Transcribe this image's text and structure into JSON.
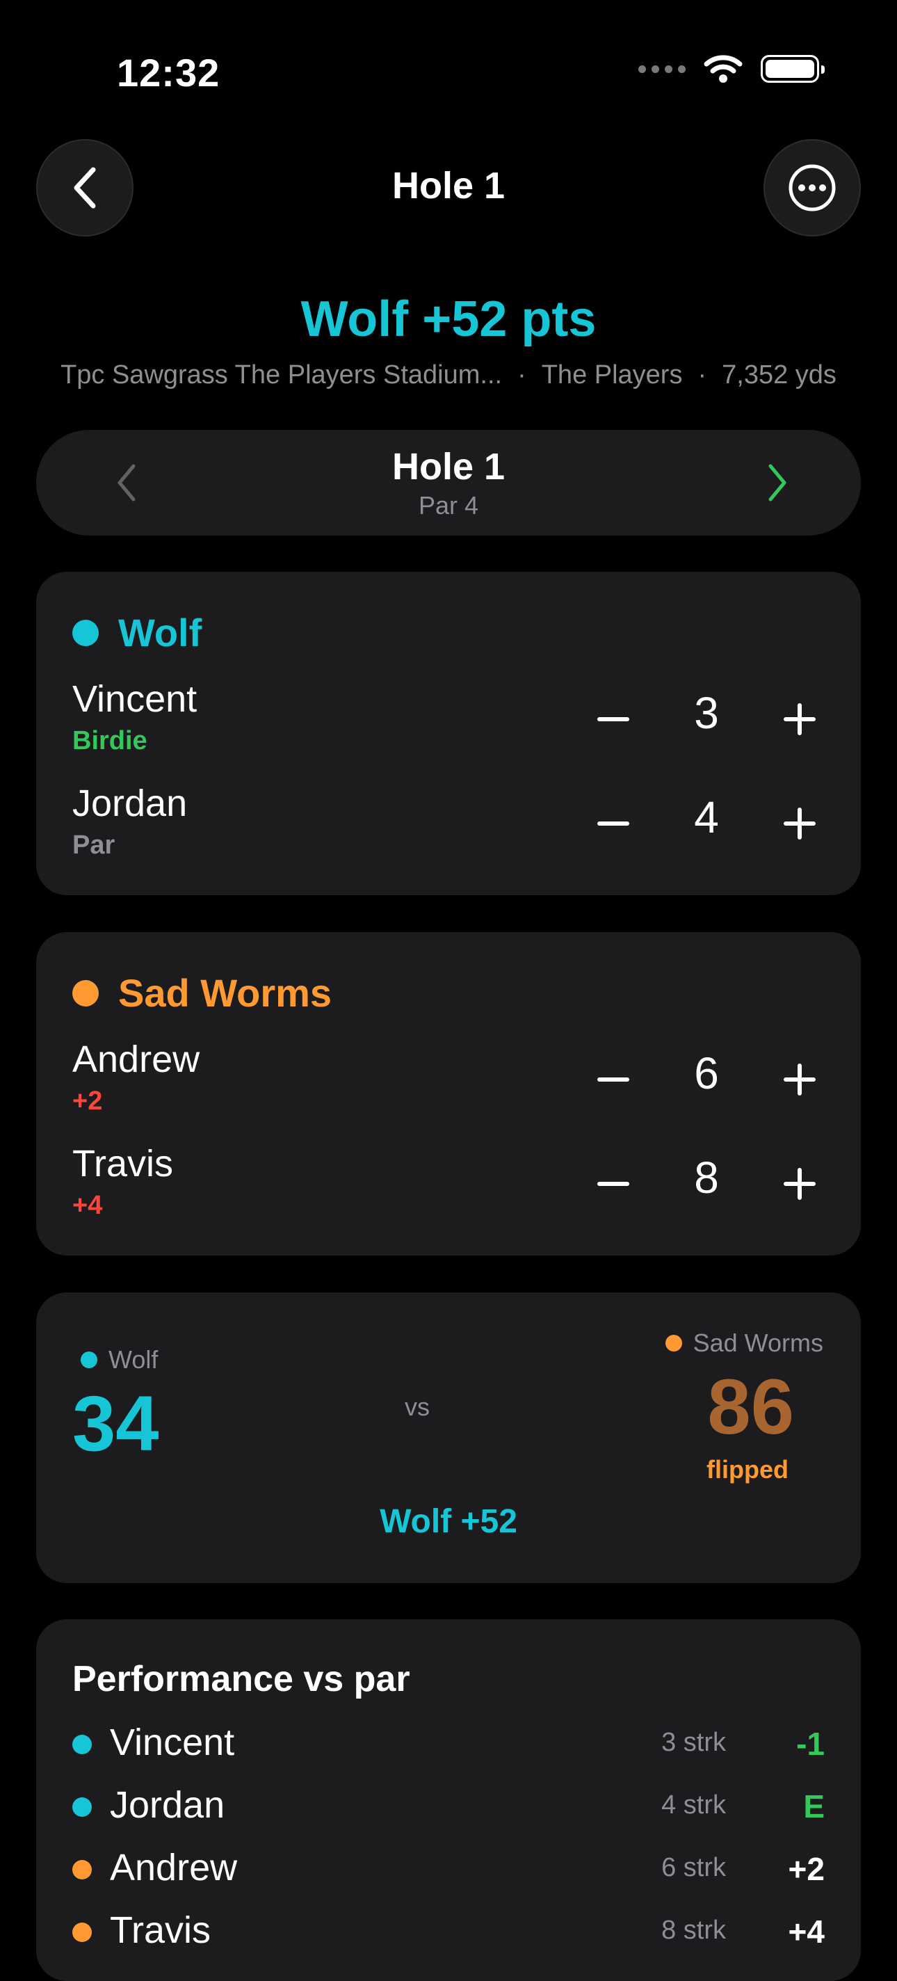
{
  "status": {
    "time": "12:32"
  },
  "nav": {
    "title": "Hole 1"
  },
  "summary": {
    "title": "Wolf +52 pts",
    "course": "Tpc Sawgrass The Players Stadium...",
    "tournament": "The Players",
    "yardage": "7,352 yds",
    "separator": "·"
  },
  "hole_selector": {
    "title": "Hole 1",
    "par": "Par 4"
  },
  "teams": [
    {
      "name": "Wolf",
      "color": "#17c6d6",
      "players": [
        {
          "name": "Vincent",
          "status": "Birdie",
          "status_color": "#34c759",
          "score": "3"
        },
        {
          "name": "Jordan",
          "status": "Par",
          "status_color": "#8e8e93",
          "score": "4"
        }
      ]
    },
    {
      "name": "Sad Worms",
      "color": "#ff9a33",
      "players": [
        {
          "name": "Andrew",
          "status": "+2",
          "status_color": "#ff453a",
          "score": "6"
        },
        {
          "name": "Travis",
          "status": "+4",
          "status_color": "#ff453a",
          "score": "8"
        }
      ]
    }
  ],
  "matchup": {
    "left_team": "Wolf",
    "left_score": "34",
    "vs": "vs",
    "right_team": "Sad Worms",
    "right_score": "86",
    "right_note": "flipped",
    "result": "Wolf +52"
  },
  "performance": {
    "title": "Performance vs par",
    "rows": [
      {
        "name": "Vincent",
        "strokes": "3 strk",
        "diff": "-1",
        "dot": "#17c6d6",
        "diff_color": "#34c759"
      },
      {
        "name": "Jordan",
        "strokes": "4 strk",
        "diff": "E",
        "dot": "#17c6d6",
        "diff_color": "#34c759"
      },
      {
        "name": "Andrew",
        "strokes": "6 strk",
        "diff": "+2",
        "dot": "#ff9a33",
        "diff_color": "#ffffff"
      },
      {
        "name": "Travis",
        "strokes": "8 strk",
        "diff": "+4",
        "dot": "#ff9a33",
        "diff_color": "#ffffff"
      }
    ]
  }
}
